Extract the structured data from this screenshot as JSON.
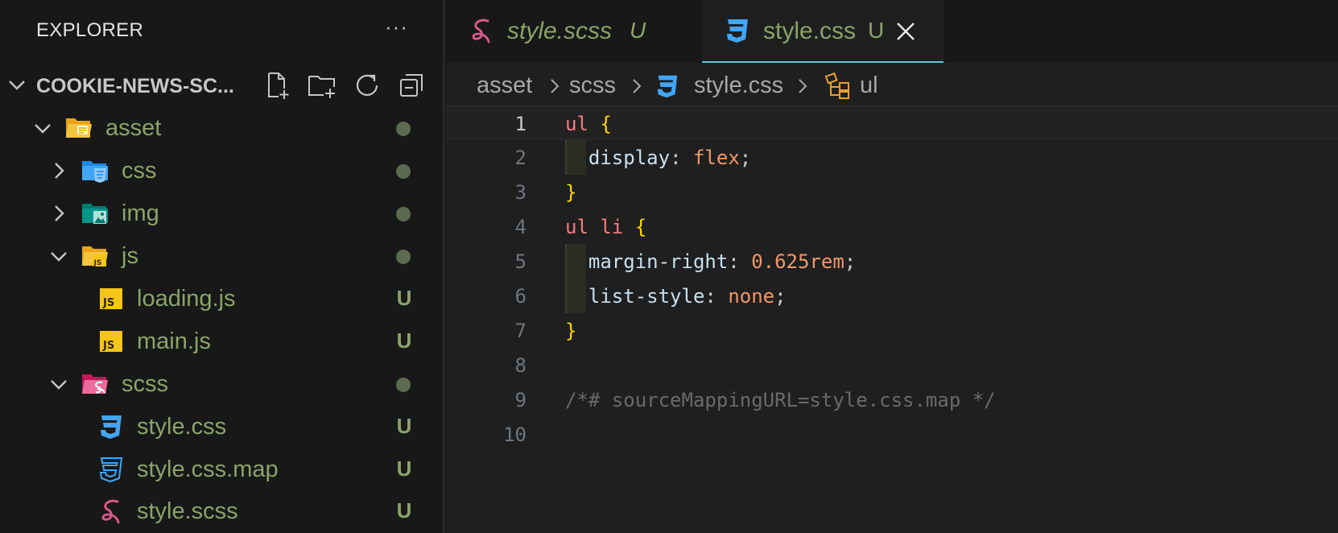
{
  "explorer": {
    "title": "EXPLORER",
    "more": "···",
    "section_title": "COOKIE-NEWS-SC...",
    "items": [
      {
        "name": "asset",
        "status": "",
        "has_dot": true
      },
      {
        "name": "css",
        "status": "",
        "has_dot": true
      },
      {
        "name": "img",
        "status": "",
        "has_dot": true
      },
      {
        "name": "js",
        "status": "",
        "has_dot": true
      },
      {
        "name": "loading.js",
        "status": "U"
      },
      {
        "name": "main.js",
        "status": "U"
      },
      {
        "name": "scss",
        "status": "",
        "has_dot": true
      },
      {
        "name": "style.css",
        "status": "U"
      },
      {
        "name": "style.css.map",
        "status": "U"
      },
      {
        "name": "style.scss",
        "status": "U"
      }
    ]
  },
  "tabs": [
    {
      "label": "style.scss",
      "status": "U",
      "icon": "sass-icon"
    },
    {
      "label": "style.css",
      "status": "U",
      "icon": "css-icon",
      "active": true
    }
  ],
  "breadcrumb": [
    "asset",
    "scss",
    "style.css",
    "ul"
  ],
  "code": {
    "lines": [
      {
        "n": "1",
        "sel": "ul",
        "brace": "{"
      },
      {
        "n": "2",
        "prop": "display",
        "val": "flex"
      },
      {
        "n": "3",
        "brace": "}"
      },
      {
        "n": "4",
        "sel": "ul li",
        "brace": "{"
      },
      {
        "n": "5",
        "prop": "margin-right",
        "val": "0.625rem"
      },
      {
        "n": "6",
        "prop": "list-style",
        "val": "none"
      },
      {
        "n": "7",
        "brace": "}"
      },
      {
        "n": "8"
      },
      {
        "n": "9",
        "comment": "/*# sourceMappingURL=style.css.map */"
      },
      {
        "n": "10"
      }
    ]
  },
  "colors": {
    "git_untracked": "#8ba36a",
    "active_tab_border": "#5cc8d6",
    "css_blue": "#42a5f5",
    "sass_pink": "#e05a8c",
    "js_yellow": "#f5c518"
  }
}
